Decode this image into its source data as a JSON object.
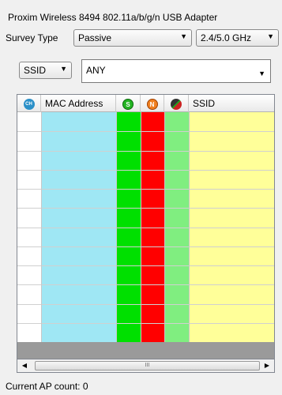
{
  "adapter": {
    "title": "Proxim Wireless 8494 802.11a/b/g/n USB Adapter"
  },
  "survey": {
    "label": "Survey Type",
    "type_value": "Passive",
    "band_value": "2.4/5.0 GHz"
  },
  "filter": {
    "field_value": "SSID",
    "text_value": "ANY"
  },
  "grid": {
    "columns": {
      "ch_icon": "CH",
      "mac": "MAC Address",
      "signal_icon": "S",
      "noise_icon": "N",
      "ssid": "SSID"
    },
    "column_colors": {
      "mac": "#9fe7f4",
      "signal": "#00e000",
      "noise": "#ff0000",
      "snr": "#80ee80",
      "ssid": "#ffff99"
    },
    "rows": []
  },
  "scrollbar": {
    "grip": "III"
  },
  "status": {
    "ap_count": "Current AP count: 0"
  },
  "icons": {
    "dropdown": "triangle-down-icon",
    "scroll_left": "triangle-left-icon",
    "scroll_right": "triangle-right-icon"
  }
}
